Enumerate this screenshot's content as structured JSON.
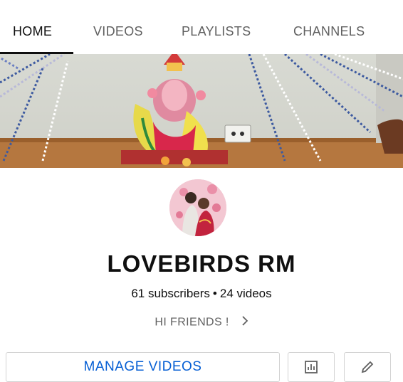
{
  "tabs": [
    {
      "label": "HOME",
      "active": true
    },
    {
      "label": "VIDEOS",
      "active": false
    },
    {
      "label": "PLAYLISTS",
      "active": false
    },
    {
      "label": "CHANNELS",
      "active": false
    }
  ],
  "channel": {
    "name": "LOVEBIRDS RM",
    "subscribers": "61 subscribers",
    "separator": "•",
    "videos": "24 videos",
    "description": "HI FRIENDS !"
  },
  "actions": {
    "manage_label": "MANAGE VIDEOS",
    "analytics_icon": "analytics-icon",
    "edit_icon": "pencil-icon"
  },
  "colors": {
    "accent_blue": "#065fd4",
    "text_primary": "#0f0f0f",
    "text_secondary": "#606060"
  }
}
